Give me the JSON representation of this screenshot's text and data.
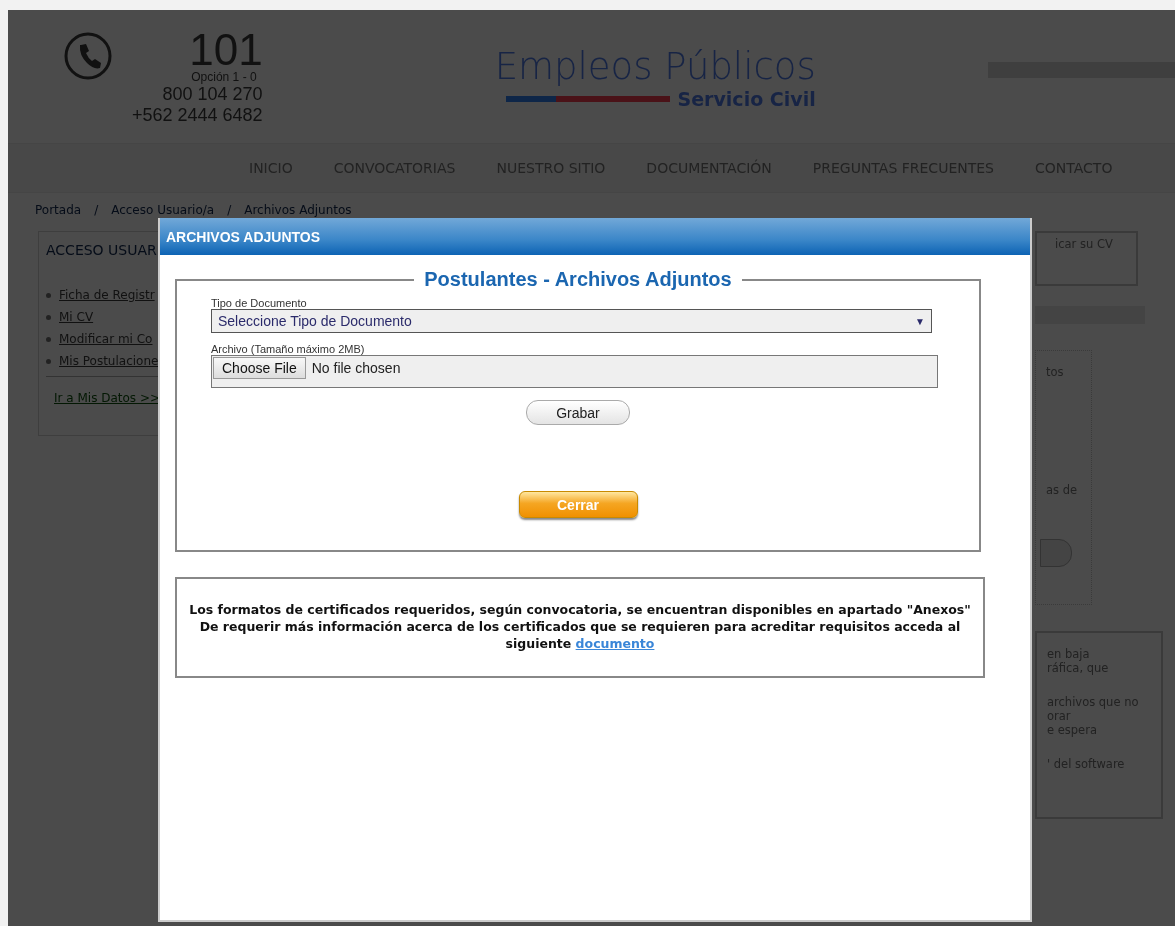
{
  "header": {
    "phone": {
      "number": "101",
      "option": "Opción 1 - 0",
      "lines": [
        "800 104 270",
        "+562 2444 6482"
      ]
    },
    "logo": {
      "title": "Empleos Públicos",
      "subtitle": "Servicio Civil"
    }
  },
  "nav": [
    {
      "label": "INICIO"
    },
    {
      "label": "CONVOCATORIAS"
    },
    {
      "label": "NUESTRO SITIO"
    },
    {
      "label": "DOCUMENTACIÓN"
    },
    {
      "label": "PREGUNTAS FRECUENTES"
    },
    {
      "label": "CONTACTO"
    }
  ],
  "breadcrumb": {
    "separator": "/",
    "items": [
      "Portada",
      "Acceso Usuario/a",
      "Archivos Adjuntos"
    ]
  },
  "sidebar": {
    "title": "ACCESO USUAR",
    "links": [
      "Ficha de Registr",
      "Mi CV",
      "Modificar mi Co",
      "Mis Postulacione"
    ],
    "footer_link": "Ir a Mis Datos >>"
  },
  "right_panel": {
    "box_1": [
      "icar su CV"
    ],
    "box_2": [
      "tos",
      "as de"
    ],
    "box_3": [
      "en baja",
      "ráfica, que",
      "archivos que no",
      "orar",
      "e espera",
      "' del software"
    ]
  },
  "modal": {
    "title": "ARCHIVOS ADJUNTOS",
    "legend": "Postulantes - Archivos Adjuntos",
    "select_label": "Tipo de Documento",
    "select_value": "Seleccione Tipo de Documento",
    "select_caret": "▼",
    "file_label": "Archivo (Tamaño máximo 2MB)",
    "file_button": "Choose File",
    "file_status": "No file chosen",
    "save_button": "Grabar",
    "close_button": "Cerrar",
    "info": {
      "line_1": "Los formatos de certificados requeridos, según convocatoria, se encuentran disponibles en apartado \"Anexos\"",
      "line_2": "De requerir más información acerca de los certificados que se requieren para acreditar requisitos acceda al siguiente",
      "link": "documento"
    }
  }
}
